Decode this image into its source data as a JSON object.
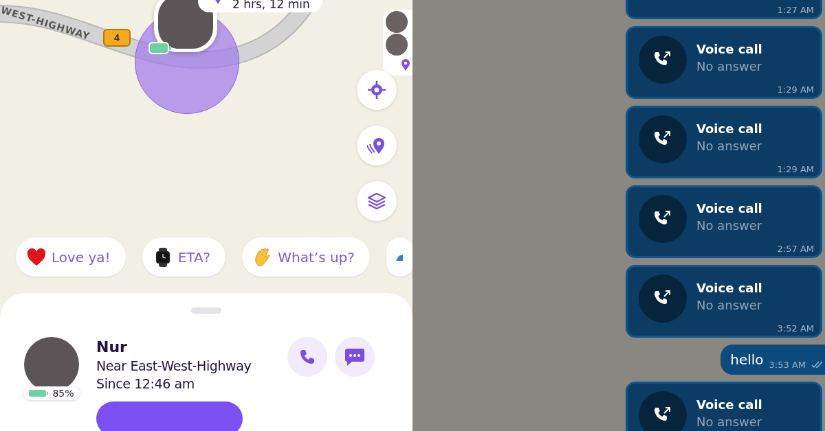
{
  "map": {
    "road_label": "WEST-HIGHWAY",
    "route_shield": "4",
    "eta": "2 hrs, 12 min"
  },
  "map_buttons": [
    {
      "kind": "recenter"
    },
    {
      "kind": "places"
    },
    {
      "kind": "layers"
    }
  ],
  "quick_messages": [
    {
      "kind": "heart",
      "label": "Love ya!"
    },
    {
      "kind": "watch",
      "label": "ETA?"
    },
    {
      "kind": "wave",
      "label": "What’s up?"
    },
    {
      "kind": "partial"
    }
  ],
  "member": {
    "name": "Nur",
    "location": "Near East-West-Highway",
    "since": "Since 12:46 am",
    "battery": "85%"
  },
  "chat": {
    "messages": [
      {
        "kind": "call",
        "time": "1:27 AM"
      },
      {
        "kind": "call",
        "title": "Voice call",
        "subtitle": "No answer",
        "time": "1:29 AM"
      },
      {
        "kind": "call",
        "title": "Voice call",
        "subtitle": "No answer",
        "time": "1:29 AM"
      },
      {
        "kind": "call",
        "title": "Voice call",
        "subtitle": "No answer",
        "time": "2:57 AM"
      },
      {
        "kind": "call",
        "title": "Voice call",
        "subtitle": "No answer",
        "time": "3:52 AM"
      },
      {
        "kind": "text",
        "text": "hello",
        "time": "3:53 AM",
        "read": true
      },
      {
        "kind": "call",
        "title": "Voice call",
        "subtitle": "No answer"
      }
    ]
  }
}
